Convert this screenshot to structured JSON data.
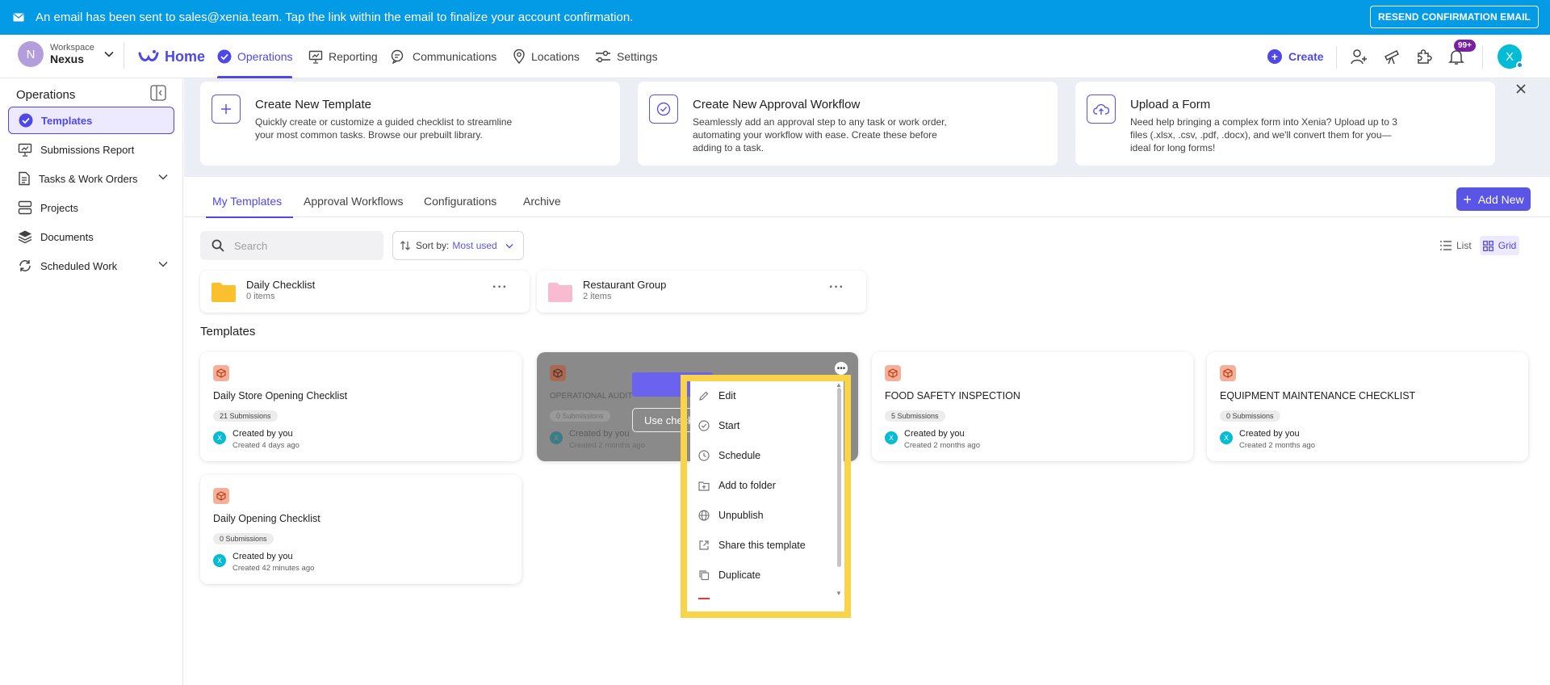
{
  "banner": {
    "message": "An email has been sent to sales@xenia.team. Tap the link within the email to finalize your account confirmation.",
    "resend_label": "RESEND CONFIRMATION EMAIL",
    "icon": "mail-icon",
    "color": "#039be5"
  },
  "topnav": {
    "workspace_initial": "N",
    "workspace_label": "Workspace",
    "workspace_name": "Nexus",
    "home_label": "Home",
    "items": [
      {
        "label": "Operations",
        "icon": "check-circle-icon",
        "active": true
      },
      {
        "label": "Reporting",
        "icon": "presentation-icon"
      },
      {
        "label": "Communications",
        "icon": "chat-icon"
      },
      {
        "label": "Locations",
        "icon": "pin-icon"
      },
      {
        "label": "Settings",
        "icon": "sliders-icon"
      }
    ],
    "create_label": "Create",
    "notification_badge": "99+",
    "user_initial": "X",
    "accent": "#4e48e8"
  },
  "sidebar": {
    "title": "Operations",
    "items": [
      {
        "label": "Templates",
        "icon": "check-circle-icon",
        "active": true
      },
      {
        "label": "Submissions Report",
        "icon": "presentation-icon"
      },
      {
        "label": "Tasks & Work Orders",
        "icon": "document-icon",
        "expandable": true
      },
      {
        "label": "Projects",
        "icon": "stack-icon"
      },
      {
        "label": "Documents",
        "icon": "layers-icon"
      },
      {
        "label": "Scheduled Work",
        "icon": "refresh-icon",
        "expandable": true
      }
    ]
  },
  "quick_actions": [
    {
      "title": "Create New Template",
      "desc_line1": "Quickly create or customize a guided checklist to streamline",
      "desc_line2": "your most common tasks. Browse our prebuilt library.",
      "desc_line3": "",
      "icon": "plus-icon"
    },
    {
      "title": "Create New Approval Workflow",
      "desc_line1": "Seamlessly add an approval step to any task or work order,",
      "desc_line2": "automating your workflow with ease. Create these before",
      "desc_line3": "adding to a task.",
      "icon": "check-circle-icon"
    },
    {
      "title": "Upload a Form",
      "desc_line1": "Need help bringing a complex form into Xenia? Upload up to 3",
      "desc_line2": "files (.xlsx, .csv, .pdf, .docx), and we'll convert them for you—",
      "desc_line3": "ideal for long forms!",
      "icon": "cloud-upload-icon"
    }
  ],
  "tabs": [
    "My Templates",
    "Approval Workflows",
    "Configurations",
    "Archive"
  ],
  "add_new_label": "Add New",
  "search": {
    "placeholder": "Search"
  },
  "sort": {
    "label": "Sort by:",
    "value": "Most used"
  },
  "view_toggle": {
    "list_label": "List",
    "grid_label": "Grid",
    "selected": "Grid"
  },
  "folders": [
    {
      "name": "Daily Checklist",
      "count": "0 items",
      "color": "#fbc02d"
    },
    {
      "name": "Restaurant Group",
      "count": "2 items",
      "color": "#f8bbd0"
    }
  ],
  "templates_heading": "Templates",
  "templates": [
    {
      "name": "Daily Store Opening Checklist",
      "submissions": "21 Submissions",
      "created_by": "Created by you",
      "created_when": "Created 4 days ago"
    },
    {
      "name": "OPERATIONAL AUDIT",
      "submissions": "0 Submissions",
      "created_by": "Created by you",
      "created_when": "Created 2 months ago",
      "use_label": "Use checklist"
    },
    {
      "name": "FOOD SAFETY INSPECTION",
      "submissions": "5 Submissions",
      "created_by": "Created by you",
      "created_when": "Created 2 months ago"
    },
    {
      "name": "EQUIPMENT MAINTENANCE CHECKLIST",
      "submissions": "0 Submissions",
      "created_by": "Created by you",
      "created_when": "Created 2 months ago"
    },
    {
      "name": "Daily Opening Checklist",
      "submissions": "0 Submissions",
      "created_by": "Created by you",
      "created_when": "Created 42 minutes ago"
    }
  ],
  "context_menu": [
    {
      "label": "Edit",
      "icon": "pencil-icon"
    },
    {
      "label": "Start",
      "icon": "check-circle-icon"
    },
    {
      "label": "Schedule",
      "icon": "clock-icon"
    },
    {
      "label": "Add to folder",
      "icon": "folder-plus-icon"
    },
    {
      "label": "Unpublish",
      "icon": "globe-icon"
    },
    {
      "label": "Share this template",
      "icon": "share-icon"
    },
    {
      "label": "Duplicate",
      "icon": "copy-icon"
    }
  ],
  "highlight_color": "#f9d449"
}
